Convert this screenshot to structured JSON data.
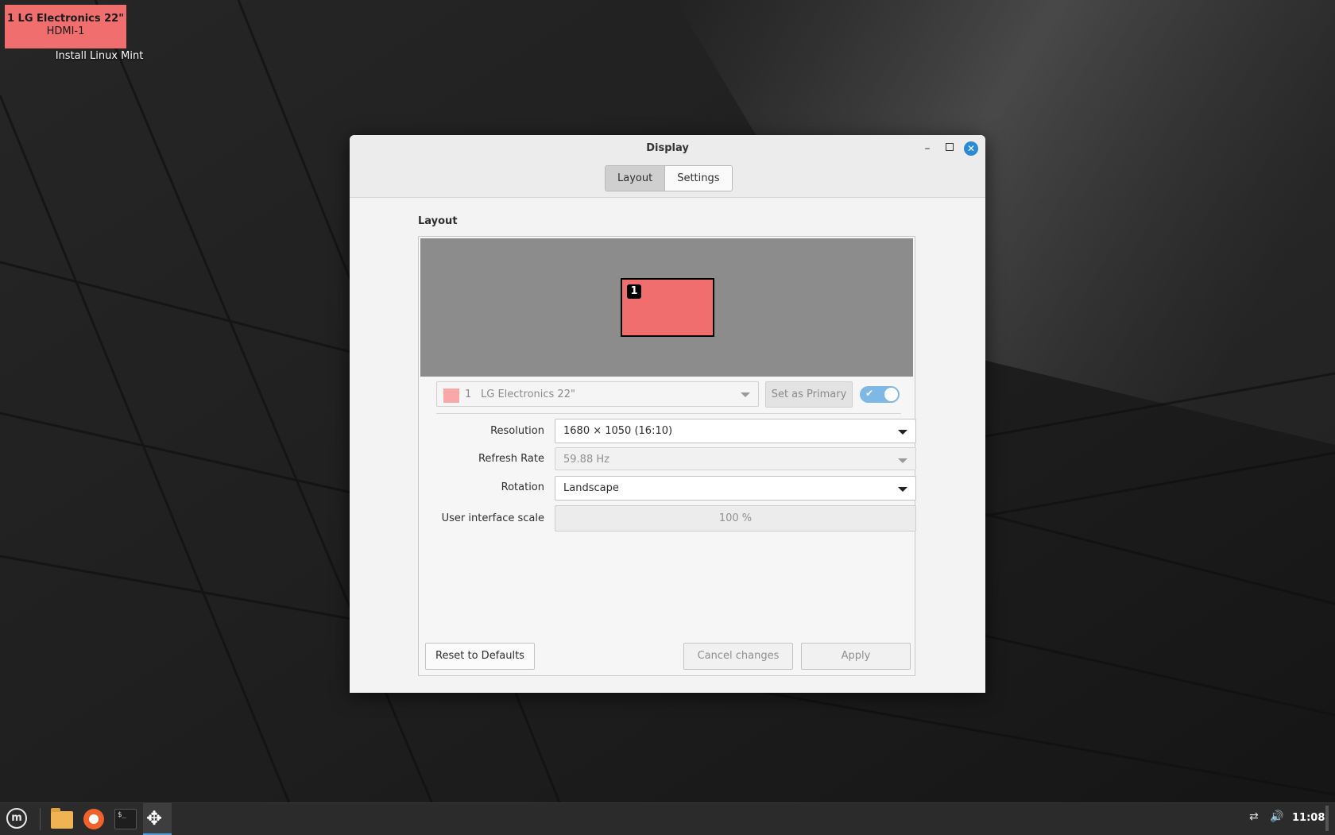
{
  "identify": {
    "line1": "1  LG Electronics 22\"",
    "line2": "HDMI-1"
  },
  "desktop": {
    "icon_label": "Install Linux Mint"
  },
  "window": {
    "title": "Display",
    "minimize": "–",
    "close": "✕"
  },
  "tabs": [
    {
      "label": "Layout",
      "active": true
    },
    {
      "label": "Settings",
      "active": false
    }
  ],
  "layout": {
    "section_title": "Layout",
    "monitor_number": "1",
    "monitor_color": "#f06e6e"
  },
  "monitor_select": {
    "number": "1",
    "name": "LG Electronics 22\""
  },
  "set_primary_label": "Set as Primary",
  "monitor_enabled": true,
  "settings": {
    "resolution": {
      "label": "Resolution",
      "value": "1680 × 1050 (16:10)"
    },
    "refresh_rate": {
      "label": "Refresh Rate",
      "value": "59.88 Hz"
    },
    "rotation": {
      "label": "Rotation",
      "value": "Landscape"
    },
    "scale": {
      "label": "User interface scale",
      "value": "100 %"
    }
  },
  "buttons": {
    "reset": "Reset to Defaults",
    "cancel": "Cancel changes",
    "apply": "Apply"
  },
  "taskbar": {
    "clock": "11:08",
    "items": [
      "menu-icon",
      "files-icon",
      "firefox-icon",
      "terminal-icon",
      "display-settings-icon"
    ],
    "term_prompt": "$_"
  },
  "colors": {
    "accent": "#2b8ad6",
    "toggle_on": "#7eb8e6"
  }
}
